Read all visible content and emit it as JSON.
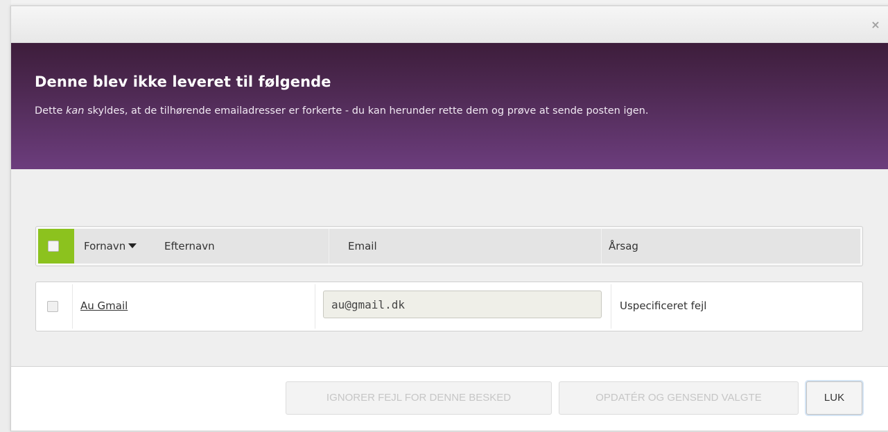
{
  "modal": {
    "close_glyph": "×",
    "title": "Denne blev ikke leveret til følgende",
    "description": {
      "before": "Dette ",
      "emphasis": "kan",
      "after": " skyldes, at de tilhørende emailadresser er forkerte - du kan herunder rette dem og prøve at sende posten igen."
    }
  },
  "table": {
    "columns": {
      "first_name": "Fornavn",
      "last_name": "Efternavn",
      "email": "Email",
      "reason": "Årsag"
    },
    "sort": {
      "column": "first_name",
      "direction": "desc"
    },
    "rows": [
      {
        "name": "Au Gmail",
        "email": "au@gmail.dk",
        "reason": "Uspecificeret fejl",
        "checked": false
      }
    ]
  },
  "footer": {
    "ignore_label": "IGNORER FEJL FOR DENNE BESKED",
    "update_label": "OPDATÉR OG GENSEND VALGTE",
    "close_label": "LUK"
  },
  "colors": {
    "header_top": "#3d1d3b",
    "header_bottom": "#6c3d7d",
    "accent_green": "#8cc21e"
  },
  "icons": {
    "close": "close-icon",
    "sort": "sort-down-icon"
  }
}
